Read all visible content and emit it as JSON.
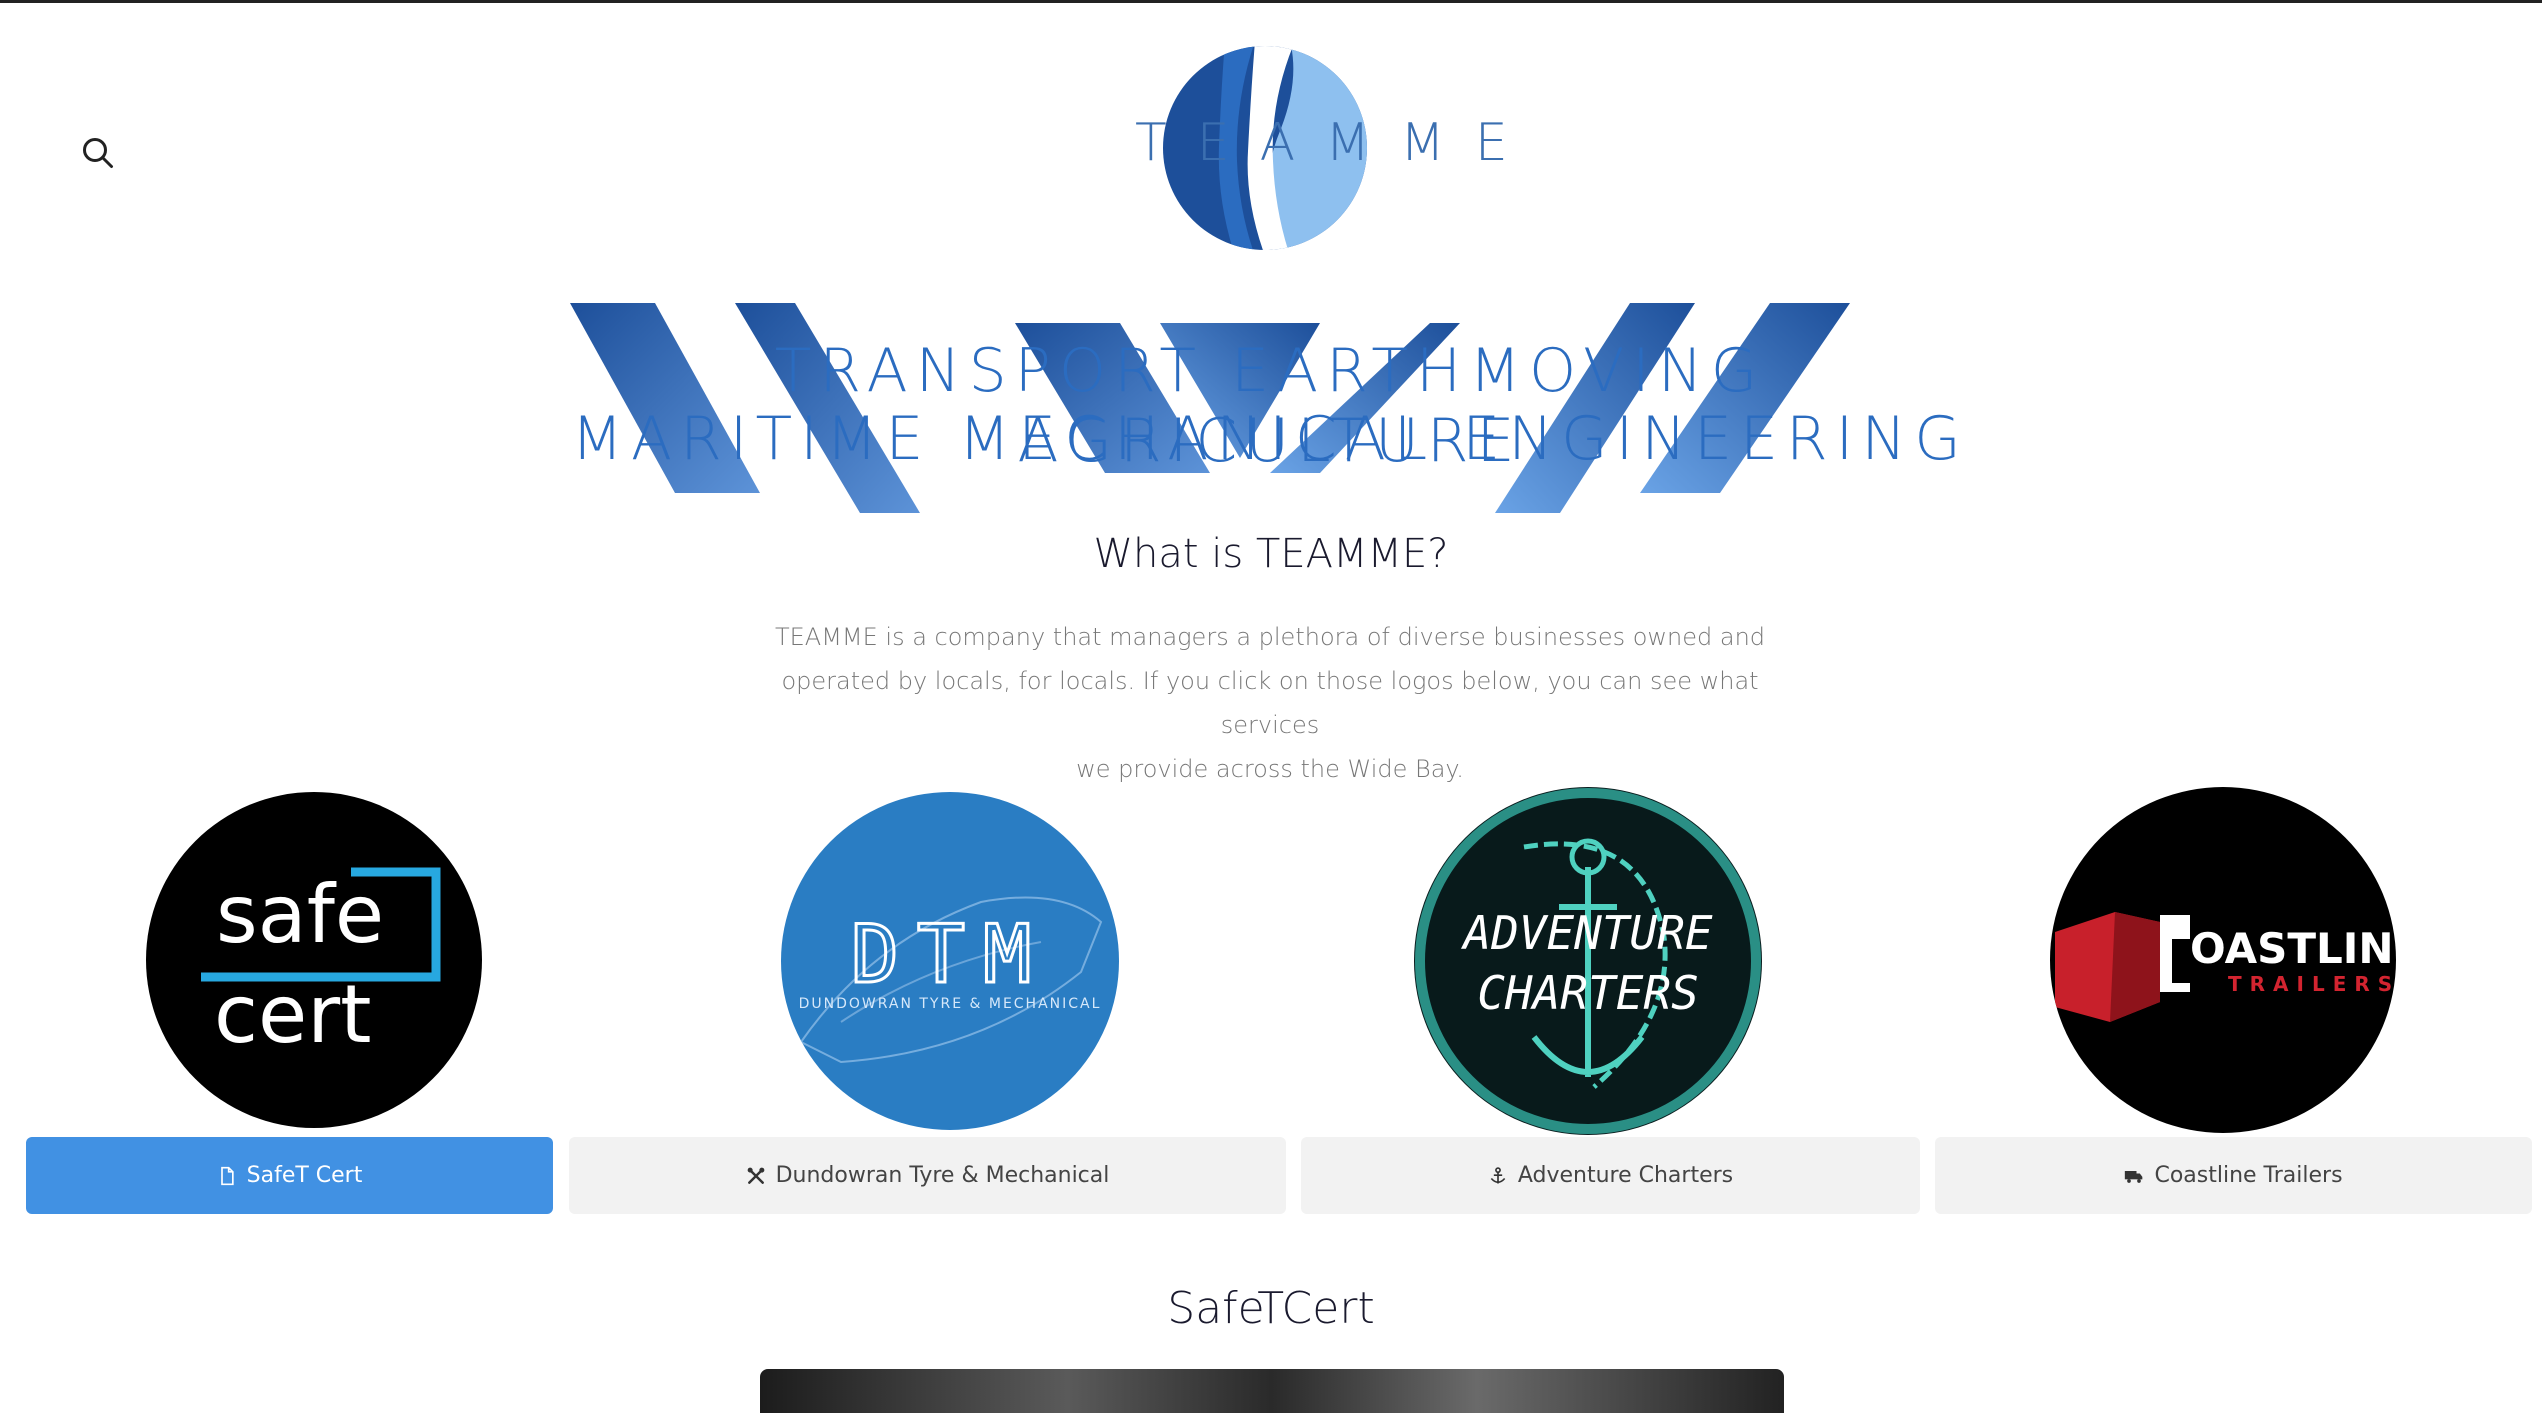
{
  "header": {
    "logo_text": "TEAMME"
  },
  "hero": {
    "line1": "TRANSPORT EARTHMOVING AGRICULTURE",
    "line2": "MARITIME MECHANICAL ENGINEERING"
  },
  "about": {
    "title": "What is TEAMME?",
    "lines": [
      "TEAMME is a company that managers a plethora of diverse businesses owned and",
      "operated by locals, for locals. If you click on those logos below, you can see what services",
      "we provide across the Wide Bay."
    ]
  },
  "businesses": [
    {
      "logo_text_1": "safe",
      "logo_text_2": "cert",
      "tab_label": "SafeT Cert",
      "tab_icon": "file-icon",
      "active": true
    },
    {
      "logo_text_1": "DTM",
      "logo_text_2": "DUNDOWRAN TYRE & MECHANICAL",
      "tab_label": "Dundowran Tyre & Mechanical",
      "tab_icon": "tools-icon",
      "active": false
    },
    {
      "logo_text_1": "ADVENTURE",
      "logo_text_2": "CHARTERS",
      "tab_label": "Adventure Charters",
      "tab_icon": "anchor-icon",
      "active": false
    },
    {
      "logo_text_1": "OASTLINE",
      "logo_text_2": "TRAILERS",
      "tab_label": "Coastline Trailers",
      "tab_icon": "truck-icon",
      "active": false
    }
  ],
  "section": {
    "title": "SafeTCert"
  },
  "colors": {
    "accent": "#4191e3",
    "hero_blue": "#2b6cc0",
    "tab_bg": "#f2f2f2"
  }
}
